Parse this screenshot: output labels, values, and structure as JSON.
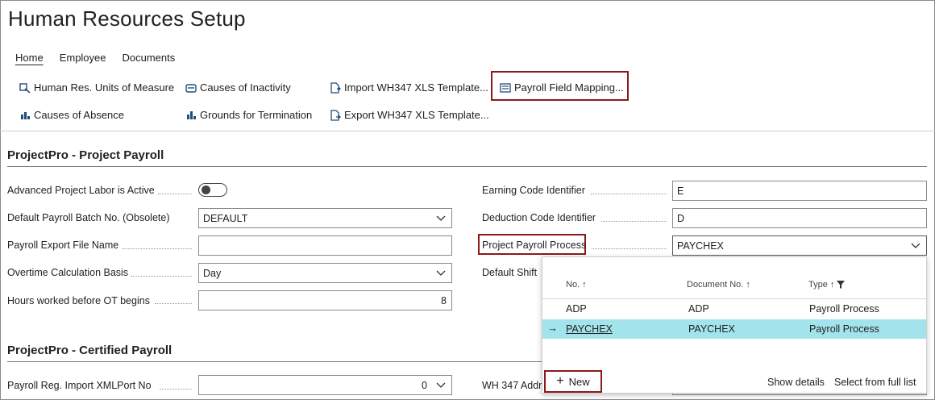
{
  "page": {
    "title": "Human Resources Setup"
  },
  "tabs": [
    {
      "label": "Home",
      "active": true
    },
    {
      "label": "Employee"
    },
    {
      "label": "Documents"
    }
  ],
  "actions": {
    "units_of_measure": "Human Res. Units of Measure",
    "causes_of_inactivity": "Causes of Inactivity",
    "import_wh347": "Import WH347 XLS Template...",
    "payroll_field_mapping": "Payroll Field Mapping...",
    "causes_of_absence": "Causes of Absence",
    "grounds_for_termination": "Grounds for Termination",
    "export_wh347": "Export WH347 XLS Template..."
  },
  "project_payroll": {
    "title": "ProjectPro - Project Payroll",
    "advanced_labor_label": "Advanced Project Labor is Active",
    "advanced_labor_on": false,
    "batch_label": "Default Payroll Batch No. (Obsolete)",
    "batch_value": "DEFAULT",
    "export_file_label": "Payroll Export File Name",
    "export_file_value": "",
    "overtime_label": "Overtime Calculation Basis",
    "overtime_value": "Day",
    "hours_ot_label": "Hours worked before OT begins",
    "hours_ot_value": "8",
    "earning_code_label": "Earning Code Identifier",
    "earning_code_value": "E",
    "deduction_code_label": "Deduction Code Identifier",
    "deduction_code_value": "D",
    "process_label": "Project Payroll Process",
    "process_value": "PAYCHEX",
    "default_shift_label": "Default Shift"
  },
  "certified_payroll": {
    "title": "ProjectPro - Certified Payroll",
    "xmlport_label": "Payroll Reg. Import XMLPort No",
    "xmlport_value": "0",
    "wh347_label": "WH 347 Addr"
  },
  "lookup": {
    "col_no": "No.",
    "col_doc": "Document No.",
    "col_type": "Type",
    "rows": [
      {
        "no": "ADP",
        "doc": "ADP",
        "type": "Payroll Process",
        "selected": false
      },
      {
        "no": "PAYCHEX",
        "doc": "PAYCHEX",
        "type": "Payroll Process",
        "selected": true
      }
    ],
    "new_label": "New",
    "show_details": "Show details",
    "select_full_list": "Select from full list"
  },
  "colors": {
    "highlight_border": "#8b1a1a",
    "selected_row": "#a3e4ec"
  }
}
